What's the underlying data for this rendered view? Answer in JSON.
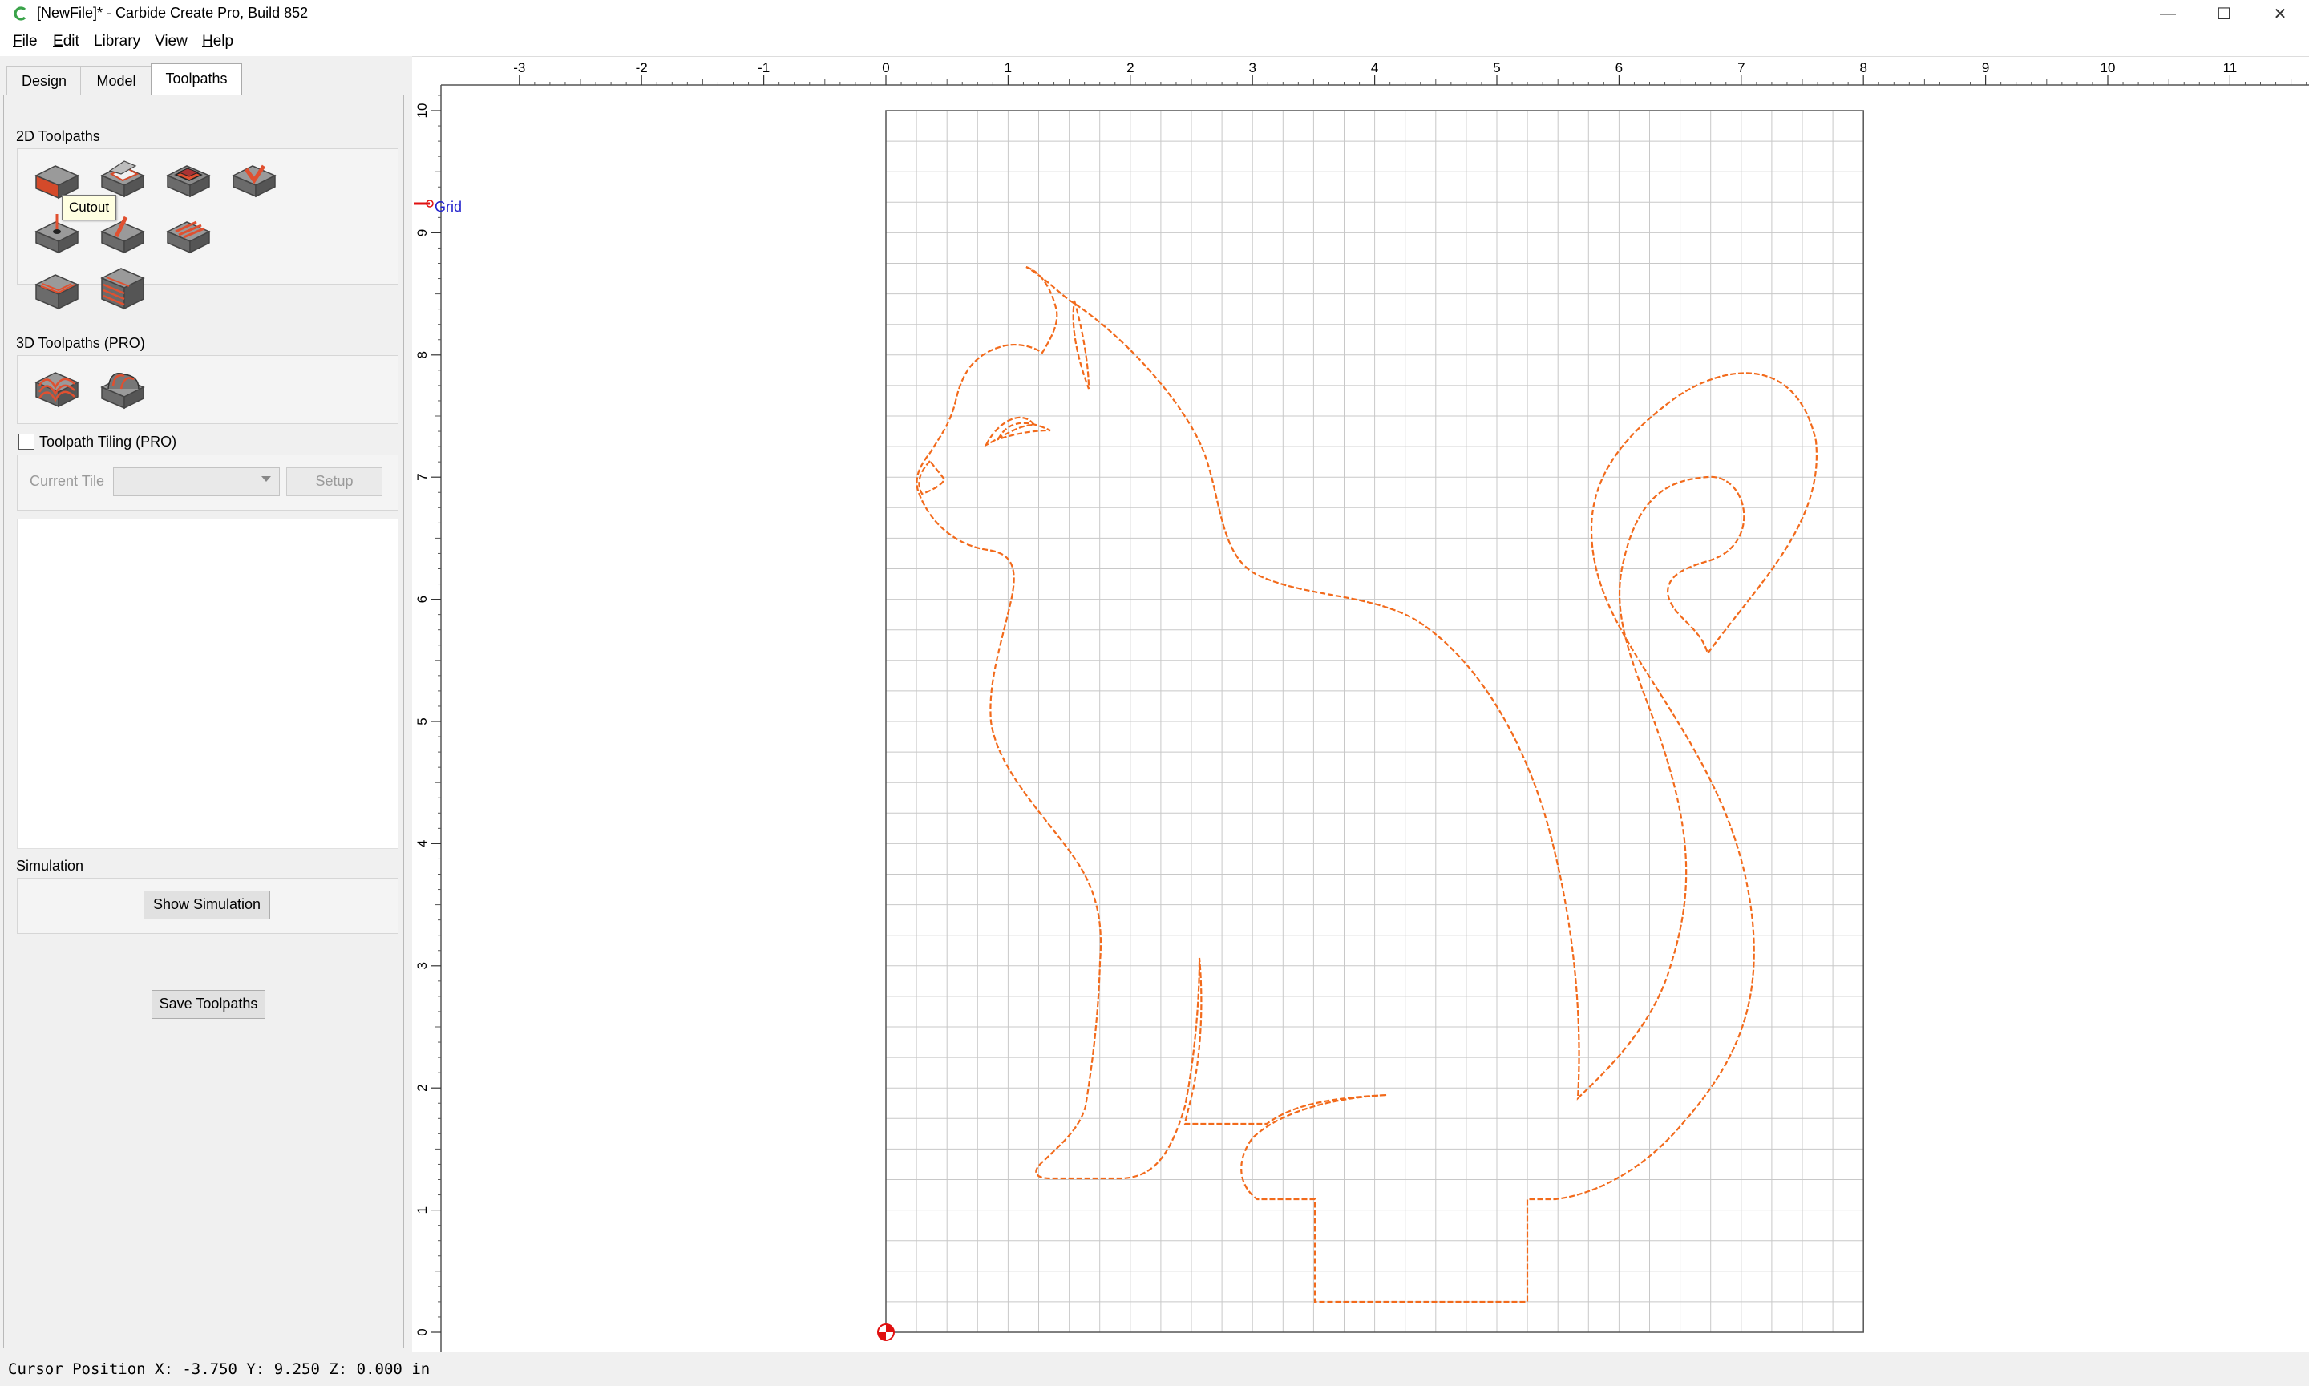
{
  "window": {
    "title": "[NewFile]* - Carbide Create Pro, Build 852",
    "controls": {
      "minimize": "—",
      "maximize": "☐",
      "close": "✕"
    }
  },
  "menu": {
    "items": [
      {
        "label": "File",
        "underline": "F"
      },
      {
        "label": "Edit",
        "underline": "E"
      },
      {
        "label": "Library",
        "underline": ""
      },
      {
        "label": "View",
        "underline": ""
      },
      {
        "label": "Help",
        "underline": "H"
      }
    ]
  },
  "tabs": [
    "Design",
    "Model",
    "Toolpaths"
  ],
  "active_tab": "Toolpaths",
  "panel": {
    "toolpaths_2d_label": "2D Toolpaths",
    "toolpaths_3d_label": "3D Toolpaths (PRO)",
    "tiling_label": "Toolpath Tiling (PRO)",
    "tiling_checked": false,
    "current_tile_label": "Current Tile",
    "current_tile_value": "",
    "setup_label": "Setup",
    "simulation_label": "Simulation",
    "show_simulation_label": "Show Simulation",
    "save_toolpaths_label": "Save Toolpaths",
    "tooltip": "Cutout",
    "tools_2d": [
      "contour-toolpath-icon",
      "pocket-toolpath-icon",
      "pocket-deep-toolpath-icon",
      "vcarve-toolpath-icon",
      "drill-toolpath-icon",
      "texture-toolpath-icon",
      "advanced-vcarve-toolpath-icon",
      "rough-toolpath-icon",
      "finish-toolpath-icon"
    ],
    "tools_3d": [
      "3d-rough-toolpath-icon",
      "3d-finish-toolpath-icon"
    ]
  },
  "canvas": {
    "x_ticks": [
      "-3",
      "-2",
      "-1",
      "0",
      "1",
      "2",
      "3",
      "4",
      "5",
      "6",
      "7",
      "8",
      "9",
      "10",
      "11"
    ],
    "y_ticks": [
      "0",
      "1",
      "2",
      "3",
      "4",
      "5",
      "6",
      "7",
      "8",
      "9",
      "10"
    ],
    "grid_label": "Grid",
    "stock_width_in": 8,
    "stock_height_in": 10,
    "colors": {
      "path": "#f26a1b",
      "grid": "#c8c8c8",
      "origin": "#e01010",
      "grid_label": "#2222cc"
    }
  },
  "status": {
    "cursor_position": "Cursor Position X: -3.750 Y: 9.250 Z: 0.000 in"
  }
}
